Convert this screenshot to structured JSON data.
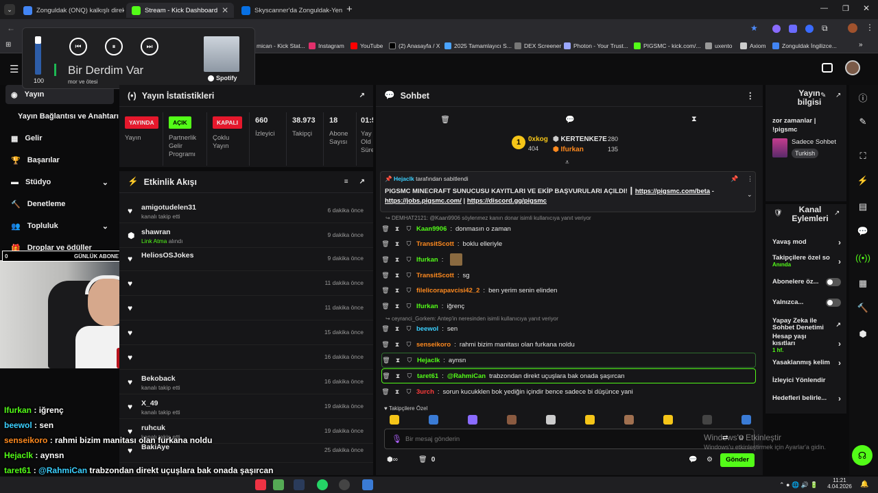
{
  "browser": {
    "tabs": [
      {
        "title": "Zonguldak (ONQ) kalkışlı direkt",
        "color": "#4285f4"
      },
      {
        "title": "Stream - Kick Dashboard",
        "color": "#53fc18"
      },
      {
        "title": "Skyscanner'da Zonguldak-Yeni",
        "color": "#0770e3"
      }
    ],
    "bookmarks": [
      "mican - Kick Stat...",
      "Instagram",
      "YouTube",
      "(2) Anasayfa / X",
      "2025 Tamamlayıcı S...",
      "DEX Screener",
      "Photon - Your Trust...",
      "PIGSMC - kick.com/...",
      "uxento",
      "Axiom",
      "Zonguldak İngilizce..."
    ]
  },
  "media": {
    "volume": "100",
    "title": "Bir Derdim Var",
    "artist": "mor ve ötesi",
    "service": "Spotify"
  },
  "nav": {
    "items": [
      {
        "label": "Yayın",
        "icon": "broadcast-icon"
      },
      {
        "label": "Yayın Bağlantısı ve Anahtarı",
        "icon": ""
      },
      {
        "label": "Gelir",
        "icon": "money-icon"
      },
      {
        "label": "Başarılar",
        "icon": "trophy-icon"
      },
      {
        "label": "Stüdyo",
        "icon": "studio-icon"
      },
      {
        "label": "Denetleme",
        "icon": "moderation-icon"
      },
      {
        "label": "Topluluk",
        "icon": "community-icon"
      },
      {
        "label": "Droplar ve ödüller",
        "icon": "drops-icon"
      }
    ]
  },
  "goal": {
    "left": "0",
    "label": "GÜNLÜK ABONE"
  },
  "stats": {
    "title": "Yayın İstatistikleri",
    "cells": [
      {
        "badge": "YAYINDA",
        "label": "Yayın",
        "color": "#e5182c"
      },
      {
        "badge": "AÇIK",
        "label": "Partnerlik Gelir Programı",
        "color": "#53fc18"
      },
      {
        "badge": "KAPALI",
        "label": "Çoklu Yayın",
        "color": "#e5182c"
      },
      {
        "num": "660",
        "label": "İzleyici"
      },
      {
        "num": "38.973",
        "label": "Takipçi"
      },
      {
        "num": "18",
        "label": "Abone Sayısı"
      },
      {
        "num": "01:5",
        "label": "Yay Old Süre"
      }
    ]
  },
  "activity": {
    "title": "Etkinlik Akışı",
    "items": [
      {
        "name": "amigotudelen31",
        "sub": "kanalı takip etti",
        "time": "6 dakika önce"
      },
      {
        "name": "shawran",
        "sub": "Link Atma",
        "sub2": "alındı",
        "time": "9 dakika önce"
      },
      {
        "name": "HeliosOSJokes",
        "sub": "",
        "time": "9 dakika önce"
      },
      {
        "name": "",
        "sub": "",
        "time": "11 dakika önce"
      },
      {
        "name": "",
        "sub": "",
        "time": "11 dakika önce"
      },
      {
        "name": "",
        "sub": "",
        "time": "15 dakika önce"
      },
      {
        "name": "",
        "sub": "",
        "time": "16 dakika önce"
      },
      {
        "name": "Bekoback",
        "sub": "kanalı takip etti",
        "time": "16 dakika önce"
      },
      {
        "name": "X_49",
        "sub": "kanalı takip etti",
        "time": "19 dakika önce"
      },
      {
        "name": "ruhcuk",
        "sub": "kanalı takip etti",
        "time": "19 dakika önce"
      },
      {
        "name": "BakiAye",
        "sub": "",
        "time": "25 dakika önce"
      }
    ]
  },
  "chat": {
    "title": "Sohbet",
    "top": [
      {
        "name": "0xkog",
        "points": "404"
      },
      {
        "name": "KERTENKE7E",
        "points": "280"
      },
      {
        "name": "Ifurkan",
        "points": "135"
      }
    ],
    "pinned": {
      "by": "Hejaclk",
      "suffix": "tarafından sabitlendi",
      "text": "PIGSMC MINECRAFT SUNUCUSU KAYITLARI VE EKİP BAŞVURULARI AÇILDI!",
      "link1": "https://pigsmc.com/beta",
      "sep": "-",
      "link2": "https://jobs.pigsmc.com/",
      "link3": "https://discord.gg/pigsmc"
    },
    "reply1": "DEMHAT2121: @Kaan9906 söylenmez kanın donar isimli kullanıcıya yanıt veriyor",
    "reply2": "ceyranci_Gorkem: Antep'in neresinden isimli kullanıcıya yanıt veriyor",
    "messages": [
      {
        "user": "Kaan9906",
        "text": "donmasın o zaman",
        "color": "#53fc18"
      },
      {
        "user": "TransitScott",
        "text": "boklu elleriyle",
        "color": "#ff8a1f"
      },
      {
        "user": "Ifurkan",
        "text": "",
        "color": "#53fc18"
      },
      {
        "user": "TransitScott",
        "text": "sg",
        "color": "#ff8a1f"
      },
      {
        "user": "filelicorapavcisi42_2",
        "text": "ben yerim senin elinden",
        "color": "#ff8a1f"
      },
      {
        "user": "Ifurkan",
        "text": "iğrenç",
        "color": "#53fc18"
      },
      {
        "user": "beewol",
        "text": "sen",
        "color": "#3bd0ff"
      },
      {
        "user": "senseikoro",
        "text": "rahmi bizim manitası olan furkana noldu",
        "color": "#ff8a1f"
      },
      {
        "user": "Hejaclk",
        "text": "aynsn",
        "color": "#53fc18"
      },
      {
        "user": "taret61",
        "mention": "@RahmiCan",
        "text": "trabzondan direkt uçuşlara bak onada şaşırcan",
        "color": "#53fc18"
      },
      {
        "user": "3urch",
        "text": "sorun kucukklen bok yediğin içindir bence sadece bi düşünce yani",
        "color": "#ff3b3b"
      }
    ],
    "emote_label": "Takipçilere Özel",
    "placeholder": "Bir mesaj gönderin",
    "count": "0",
    "send": "Gönder"
  },
  "info": {
    "title": "Yayın bilgisi",
    "stream_title": "zor zamanlar | !pigsmc",
    "category": "Sadece Sohbet",
    "lang": "Turkish"
  },
  "actions": {
    "title": "Kanal Eylemleri",
    "items": [
      {
        "label": "Yavaş mod",
        "type": "arrow"
      },
      {
        "label": "Takipçilere özel so",
        "sub": "Anında",
        "type": "arrow"
      },
      {
        "label": "Abonelere öz...",
        "type": "toggle"
      },
      {
        "label": "Yalnızca...",
        "type": "toggle"
      },
      {
        "label": "Yapay Zeka ile Sohbet Denetimi",
        "type": "ext"
      },
      {
        "label": "Hesap yaşı kısıtları",
        "sub": "1 hf.",
        "type": "arrow"
      },
      {
        "label": "Yasaklanmış kelim",
        "type": "arrow"
      },
      {
        "label": "İzleyici Yönlendir",
        "type": "none"
      },
      {
        "label": "Hedefleri belirle...",
        "type": "arrow"
      }
    ]
  },
  "overlay": {
    "lines": [
      {
        "user": "Ifurkan",
        "text": "iğrenç",
        "color": "#53fc18"
      },
      {
        "user": "beewol",
        "text": "sen",
        "color": "#3bd0ff"
      },
      {
        "user": "senseikoro",
        "text": "rahmi bizim manitası olan furkana noldu",
        "color": "#ff8a1f"
      },
      {
        "user": "Hejaclk",
        "text": "aynsn",
        "color": "#53fc18"
      },
      {
        "user": "taret61",
        "mention": "@RahmiCan",
        "text": "trabzondan direkt uçuşlara bak onada şaşırcan",
        "color": "#53fc18"
      },
      {
        "user": "3urch",
        "text": "sorun kucukklen bok yediğin içindir bence sadece bi düşünce yani",
        "color": "#ff3b3b"
      }
    ]
  },
  "windows": {
    "watermark1": "Windows'u Etkinleştir",
    "watermark2": "Windows'u etkinleştirmek için Ayarlar'a gidin.",
    "time": "11:21",
    "date": "4.04.2026"
  }
}
